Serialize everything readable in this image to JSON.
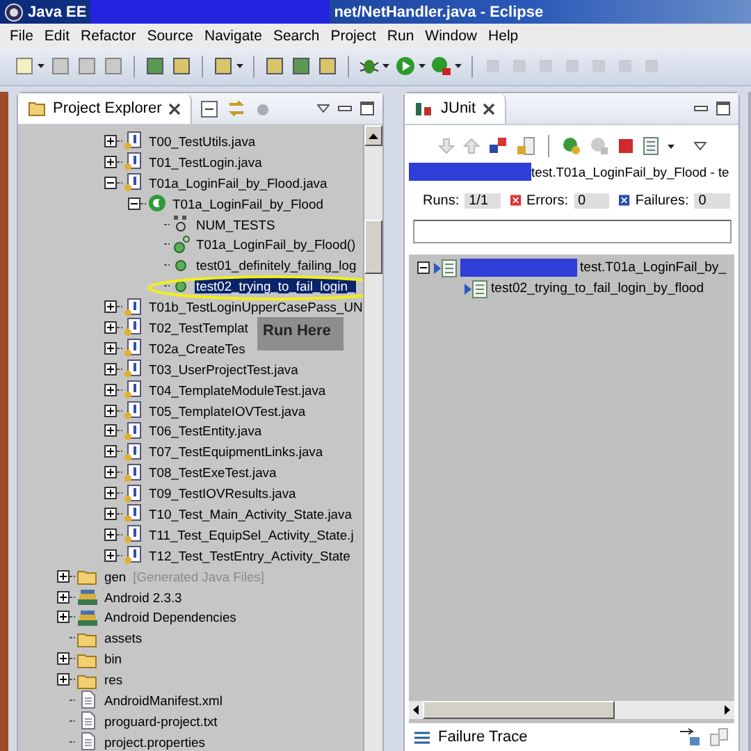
{
  "window": {
    "title_left": "Java EE",
    "title_right": "net/NetHandler.java - Eclipse"
  },
  "menu": [
    "File",
    "Edit",
    "Refactor",
    "Source",
    "Navigate",
    "Search",
    "Project",
    "Run",
    "Window",
    "Help"
  ],
  "explorer": {
    "title": "Project Explorer",
    "tree": {
      "files": [
        {
          "label": "T00_TestUtils.java",
          "kind": "java",
          "expanded": false,
          "selected": false
        },
        {
          "label": "T01_TestLogin.java",
          "kind": "java",
          "expanded": false,
          "selected": false
        },
        {
          "label": "T01a_LoginFail_by_Flood.java",
          "kind": "java",
          "expanded": true,
          "selected": false,
          "children": [
            {
              "label": "T01a_LoginFail_by_Flood",
              "kind": "class",
              "expanded": true,
              "selected": false,
              "children": [
                {
                  "label": "NUM_TESTS",
                  "kind": "field",
                  "selected": false
                },
                {
                  "label": "T01a_LoginFail_by_Flood()",
                  "kind": "constructor",
                  "selected": false
                },
                {
                  "label": "test01_definitely_failing_log",
                  "kind": "method",
                  "selected": false
                },
                {
                  "label": "test02_trying_to_fail_login_",
                  "kind": "method",
                  "selected": true
                }
              ]
            }
          ]
        },
        {
          "label": "T01b_TestLoginUpperCasePass_UN",
          "kind": "java",
          "expanded": false,
          "selected": false
        },
        {
          "label": "T02_TestTemplat",
          "kind": "java",
          "expanded": false,
          "selected": false
        },
        {
          "label": "T02a_CreateTes",
          "kind": "java",
          "expanded": false,
          "selected": false
        },
        {
          "label": "T03_UserProjectTest.java",
          "kind": "java",
          "expanded": false,
          "selected": false
        },
        {
          "label": "T04_TemplateModuleTest.java",
          "kind": "java",
          "expanded": false,
          "selected": false
        },
        {
          "label": "T05_TemplateIOVTest.java",
          "kind": "java",
          "expanded": false,
          "selected": false
        },
        {
          "label": "T06_TestEntity.java",
          "kind": "java",
          "expanded": false,
          "selected": false
        },
        {
          "label": "T07_TestEquipmentLinks.java",
          "kind": "java",
          "expanded": false,
          "selected": false
        },
        {
          "label": "T08_TestExeTest.java",
          "kind": "java",
          "expanded": false,
          "selected": false
        },
        {
          "label": "T09_TestIOVResults.java",
          "kind": "java",
          "expanded": false,
          "selected": false
        },
        {
          "label": "T10_Test_Main_Activity_State.java",
          "kind": "java",
          "expanded": false,
          "selected": false
        },
        {
          "label": "T11_Test_EquipSel_Activity_State.j",
          "kind": "java",
          "expanded": false,
          "selected": false
        },
        {
          "label": "T12_Test_TestEntry_Activity_State",
          "kind": "java",
          "expanded": false,
          "selected": false
        }
      ],
      "project_items": [
        {
          "label": "gen",
          "note": "[Generated Java Files]",
          "kind": "folder",
          "expanded": false,
          "selected": false
        },
        {
          "label": "Android 2.3.3",
          "kind": "library",
          "expanded": false,
          "selected": false
        },
        {
          "label": "Android Dependencies",
          "kind": "library",
          "expanded": false,
          "selected": false
        },
        {
          "label": "assets",
          "kind": "folder",
          "selected": false
        },
        {
          "label": "bin",
          "kind": "folder",
          "expanded": false,
          "selected": false
        },
        {
          "label": "res",
          "kind": "folder",
          "expanded": false,
          "selected": false
        },
        {
          "label": "AndroidManifest.xml",
          "kind": "file",
          "selected": false
        },
        {
          "label": "proguard-project.txt",
          "kind": "file",
          "selected": false
        },
        {
          "label": "project.properties",
          "kind": "file",
          "selected": false
        }
      ]
    },
    "annotation": {
      "text": "Run Here"
    }
  },
  "junit": {
    "title": "JUnit",
    "header_text": "test.T01a_LoginFail_by_Flood - te",
    "counters": [
      {
        "kind": "runs",
        "label": "Runs:",
        "value": "1/1"
      },
      {
        "kind": "errors",
        "label": "Errors:",
        "value": "0"
      },
      {
        "kind": "failures",
        "label": "Failures:",
        "value": "0"
      }
    ],
    "progress": {
      "level": 0
    },
    "results": [
      {
        "label": "test.T01a_LoginFail_by_",
        "expanded": true,
        "children": [
          {
            "label": "test02_trying_to_fail_login_by_flood"
          }
        ]
      }
    ],
    "failure_trace": "Failure Trace"
  }
}
